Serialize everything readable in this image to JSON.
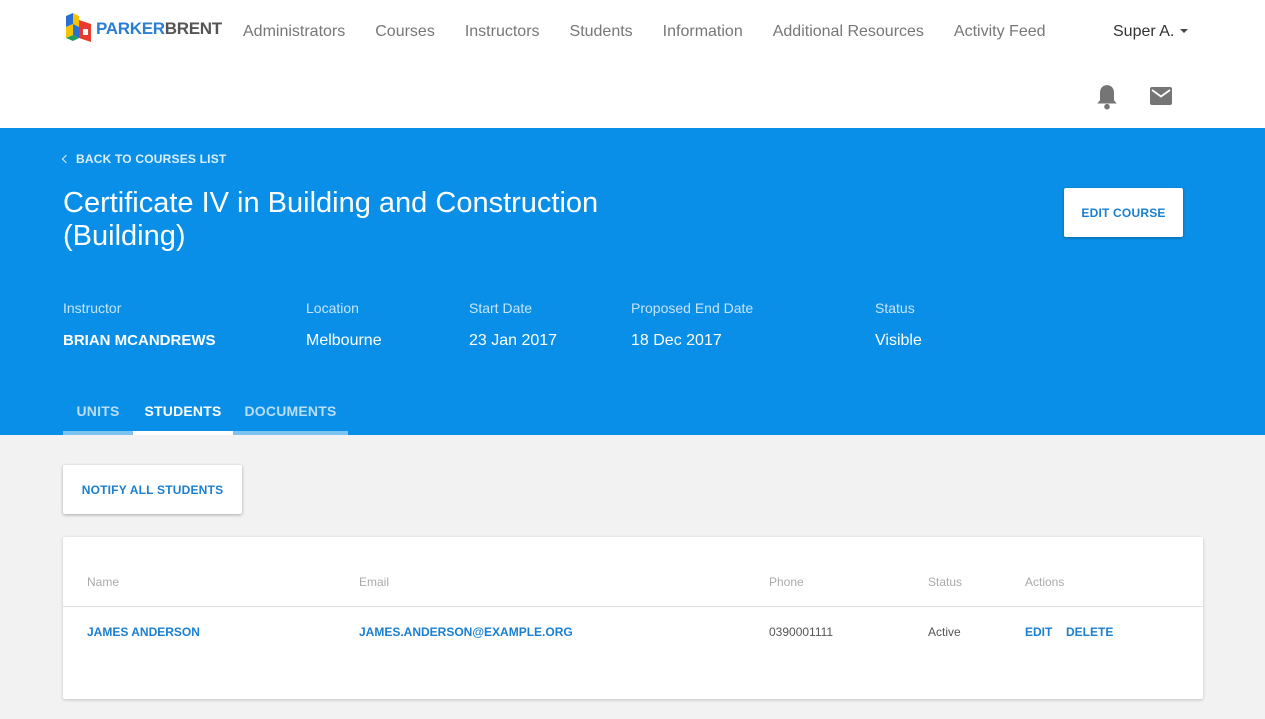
{
  "brand": {
    "logo_text_1": "PARKER",
    "logo_text_2": "BRENT"
  },
  "nav": {
    "items": [
      {
        "label": "Administrators"
      },
      {
        "label": "Courses"
      },
      {
        "label": "Instructors"
      },
      {
        "label": "Students"
      },
      {
        "label": "Information"
      },
      {
        "label": "Additional Resources"
      },
      {
        "label": "Activity Feed"
      }
    ],
    "user_label": "Super A.",
    "icons": [
      "bell-icon",
      "mail-icon"
    ]
  },
  "header": {
    "back_label": "BACK TO COURSES LIST",
    "title": "Certificate IV in Building and Construction (Building)",
    "edit_button": "EDIT COURSE",
    "meta": {
      "instructor_label": "Instructor",
      "instructor_value": "BRIAN MCANDREWS",
      "location_label": "Location",
      "location_value": "Melbourne",
      "start_label": "Start Date",
      "start_value": "23 Jan 2017",
      "end_label": "Proposed End Date",
      "end_value": "18 Dec 2017",
      "status_label": "Status",
      "status_value": "Visible"
    },
    "tabs": [
      {
        "label": "UNITS",
        "active": false
      },
      {
        "label": "STUDENTS",
        "active": true
      },
      {
        "label": "DOCUMENTS",
        "active": false
      }
    ]
  },
  "main": {
    "notify_button": "NOTIFY ALL STUDENTS",
    "table": {
      "columns": [
        "Name",
        "Email",
        "Phone",
        "Status",
        "Actions"
      ],
      "rows": [
        {
          "name": "JAMES ANDERSON",
          "email": "JAMES.ANDERSON@EXAMPLE.ORG",
          "phone": "0390001111",
          "status": "Active",
          "action_edit": "EDIT",
          "action_delete": "DELETE"
        }
      ]
    }
  },
  "colors": {
    "primary": "#0a8fe8",
    "link": "#1a7fd0",
    "background": "#f2f2f2"
  }
}
